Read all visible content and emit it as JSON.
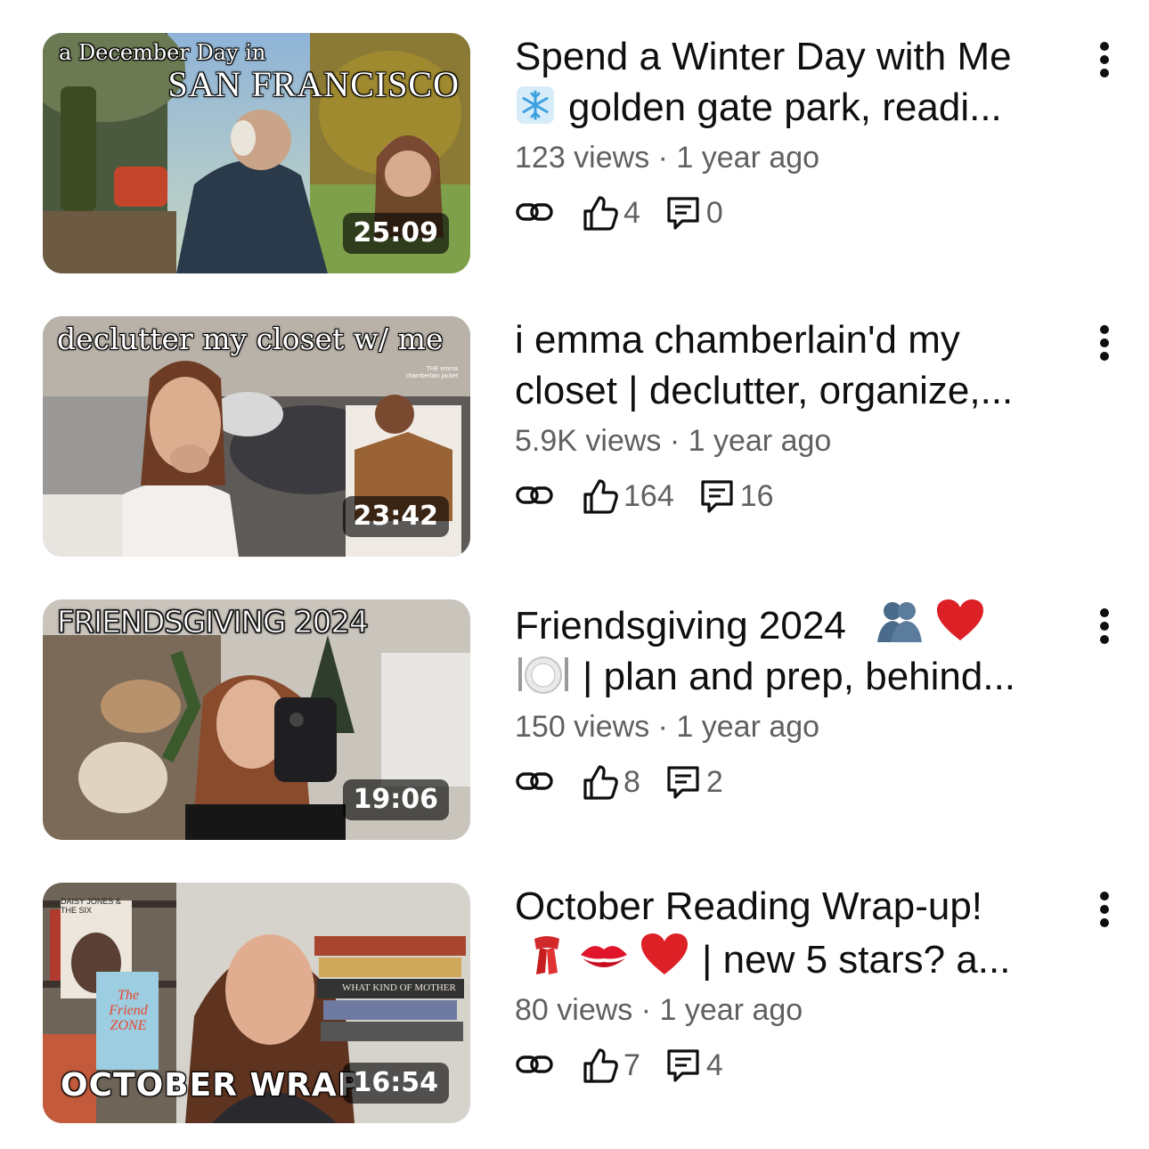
{
  "videos": [
    {
      "thumb_text_1": "a December Day in",
      "thumb_text_2": "SAN FRANCISCO",
      "duration": "25:09",
      "title_line1": "Spend a Winter Day with Me",
      "title_line2": "golden gate park, readi...",
      "title_emoji_icon": "snowflake-emoji",
      "meta": "123 views · 1 year ago",
      "likes": "4",
      "comments": "0"
    },
    {
      "thumb_text_1": "declutter my closet w/ me",
      "thumb_text_2": "THE emma chamberlain jacket",
      "duration": "23:42",
      "title_line1": "i emma chamberlain'd my",
      "title_line2": "closet | declutter, organize,...",
      "meta": "5.9K views · 1 year ago",
      "likes": "164",
      "comments": "16"
    },
    {
      "thumb_text_1": "FRIENDSGIVING 2024",
      "duration": "19:06",
      "title_line1": "Friendsgiving 2024",
      "title_line2": "| plan and prep, behind...",
      "title_emoji_icons": [
        "people-hugging-emoji",
        "red-heart-emoji",
        "plate-cutlery-emoji"
      ],
      "meta": "150 views · 1 year ago",
      "likes": "8",
      "comments": "2"
    },
    {
      "thumb_text_1": "OCTOBER WRAP UP",
      "thumb_book_1": "DAISY JONES & THE SIX",
      "thumb_book_2": "The Friend ZONE",
      "thumb_book_3": "WHAT KIND OF MOTHER",
      "duration": "16:54",
      "title_line1": "October Reading Wrap-up!",
      "title_line2": "| new 5 stars? a...",
      "title_emoji_icons": [
        "scarf-emoji",
        "kiss-mark-emoji",
        "red-heart-emoji"
      ],
      "meta": "80 views · 1 year ago",
      "likes": "7",
      "comments": "4"
    }
  ]
}
